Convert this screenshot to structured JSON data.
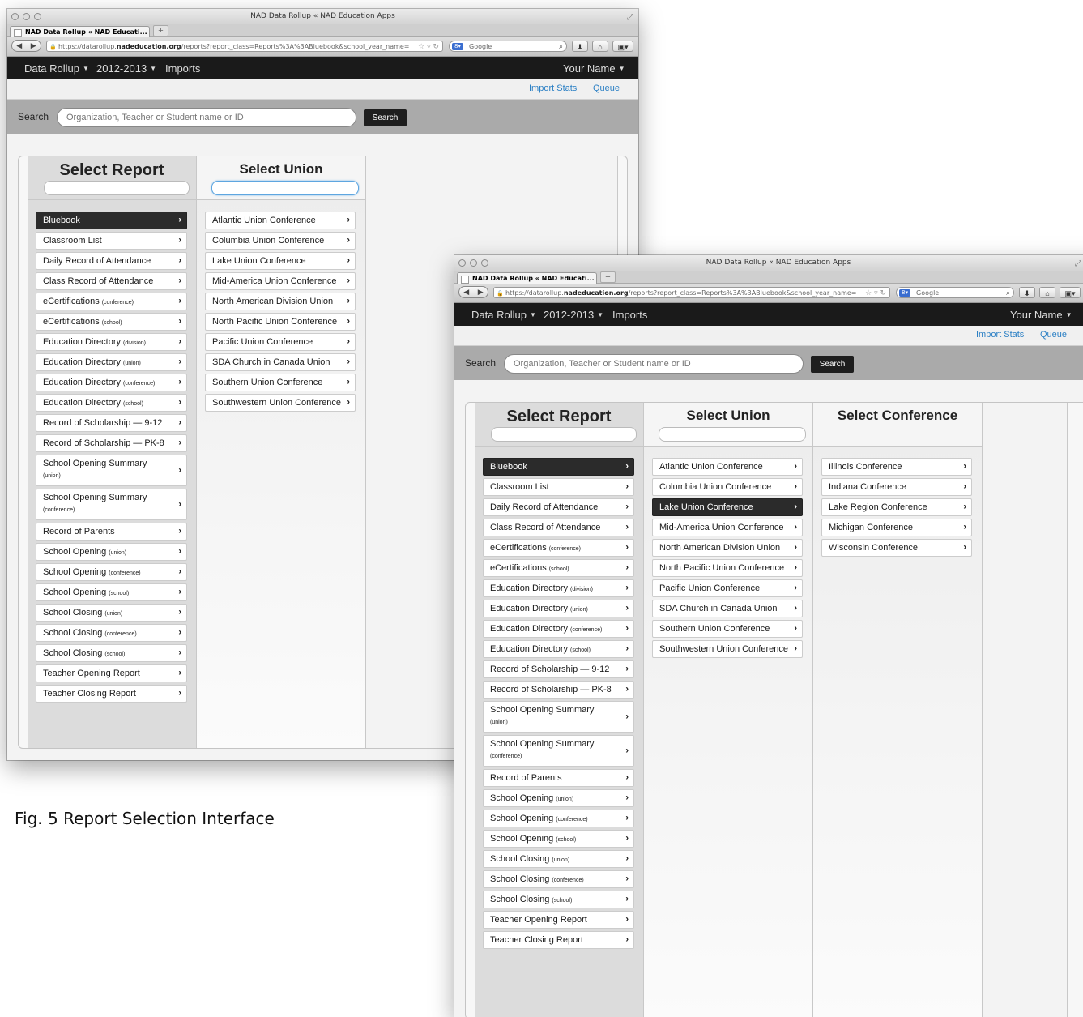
{
  "window": {
    "title": "NAD Data Rollup « NAD Education Apps",
    "tab_label": "NAD Data Rollup « NAD Educati...",
    "url_prefix": "https://datarollup.",
    "url_host": "nadeducation.org",
    "url_rest": "/reports?report_class=Reports%3A%3ABluebook&school_year_name=",
    "search_engine": "Google"
  },
  "nav": {
    "app": "Data Rollup",
    "year": "2012-2013",
    "imports": "Imports",
    "user": "Your Name"
  },
  "subnav": {
    "import_stats": "Import Stats",
    "queue": "Queue"
  },
  "search": {
    "label": "Search",
    "placeholder": "Organization, Teacher or Student name or ID",
    "button": "Search"
  },
  "columns": {
    "report": "Select Report",
    "union": "Select Union",
    "conference": "Select Conference"
  },
  "reports": [
    {
      "label": "Bluebook",
      "sub": ""
    },
    {
      "label": "Classroom List",
      "sub": ""
    },
    {
      "label": "Daily Record of Attendance",
      "sub": ""
    },
    {
      "label": "Class Record of Attendance",
      "sub": ""
    },
    {
      "label": "eCertifications",
      "sub": "(conference)"
    },
    {
      "label": "eCertifications",
      "sub": "(school)"
    },
    {
      "label": "Education Directory",
      "sub": "(division)"
    },
    {
      "label": "Education Directory",
      "sub": "(union)"
    },
    {
      "label": "Education Directory",
      "sub": "(conference)"
    },
    {
      "label": "Education Directory",
      "sub": "(school)"
    },
    {
      "label": "Record of Scholarship — 9-12",
      "sub": ""
    },
    {
      "label": "Record of Scholarship — PK-8",
      "sub": ""
    },
    {
      "label": "School Opening Summary",
      "sub": "(union)"
    },
    {
      "label": "School Opening Summary",
      "sub": "(conference)"
    },
    {
      "label": "Record of Parents",
      "sub": ""
    },
    {
      "label": "School Opening",
      "sub": "(union)"
    },
    {
      "label": "School Opening",
      "sub": "(conference)"
    },
    {
      "label": "School Opening",
      "sub": "(school)"
    },
    {
      "label": "School Closing",
      "sub": "(union)"
    },
    {
      "label": "School Closing",
      "sub": "(conference)"
    },
    {
      "label": "School Closing",
      "sub": "(school)"
    },
    {
      "label": "Teacher Opening Report",
      "sub": ""
    },
    {
      "label": "Teacher Closing Report",
      "sub": ""
    }
  ],
  "unions": [
    "Atlantic Union Conference",
    "Columbia Union Conference",
    "Lake Union Conference",
    "Mid-America Union Conference",
    "North American Division Union",
    "North Pacific Union Conference",
    "Pacific Union Conference",
    "SDA Church in Canada Union",
    "Southern Union Conference",
    "Southwestern Union Conference"
  ],
  "conferences": [
    "Illinois Conference",
    "Indiana Conference",
    "Lake Region Conference",
    "Michigan Conference",
    "Wisconsin Conference"
  ],
  "selected": {
    "report": "Bluebook",
    "union_b": "Lake Union Conference"
  },
  "caption": "Fig. 5  Report Selection Interface"
}
